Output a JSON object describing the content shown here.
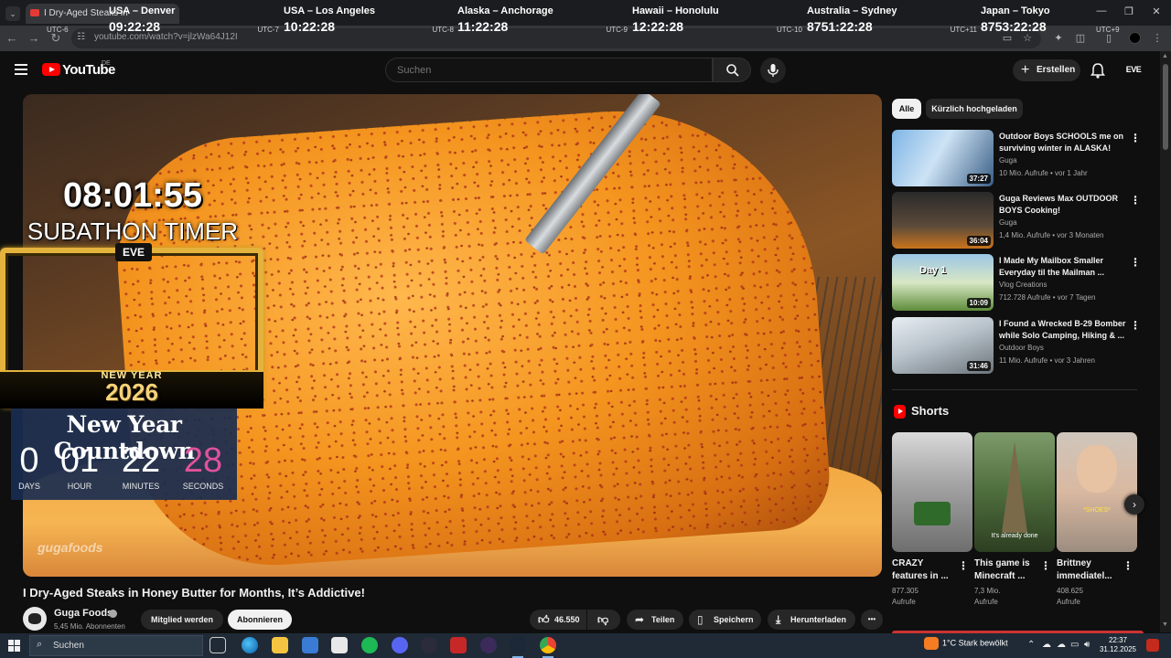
{
  "browser": {
    "tab_title": "I Dry-Aged Steaks in",
    "url": "youtube.com/watch?v=jlzWa64J12I"
  },
  "world_clocks": [
    {
      "city": "USA – Denver",
      "time": "09:22:28",
      "utc": "UTC-6"
    },
    {
      "city": "USA – Los Angeles",
      "time": "10:22:28",
      "utc": "UTC-7"
    },
    {
      "city": "Alaska – Anchorage",
      "time": "11:22:28",
      "utc": "UTC-8"
    },
    {
      "city": "Hawaii – Honolulu",
      "time": "12:22:28",
      "utc": "UTC-9"
    },
    {
      "city": "Australia – Sydney",
      "time": "8751:22:28",
      "utc": "UTC-10"
    },
    {
      "city": "Japan – Tokyo",
      "time": "8753:22:28",
      "utc": "UTC+11"
    }
  ],
  "extra_utc": "UTC+9",
  "youtube": {
    "logo_text": "YouTube",
    "country": "DE",
    "search_placeholder": "Suchen",
    "create_label": "Erstellen",
    "account_badge": "EVE"
  },
  "overlay": {
    "subathon_time": "08:01:55",
    "subathon_label": "SUBATHON TIMER",
    "frame_logo": "EVE",
    "new_year_small": "NEW YEAR",
    "new_year_big": "2026",
    "countdown_title": "New Year Countdown",
    "countdown": [
      {
        "value": "0",
        "label": "DAYS"
      },
      {
        "value": "01",
        "label": "HOUR"
      },
      {
        "value": "22",
        "label": "MINUTES"
      },
      {
        "value": "28",
        "label": "SECONDS"
      }
    ],
    "seconds_color": "#e0529a",
    "watermark": "gugafoods"
  },
  "video": {
    "title": "I Dry-Aged Steaks in Honey Butter for Months, It’s Addictive!",
    "channel": "Guga Foods",
    "subscribers": "5,45 Mio. Abonnenten",
    "join_label": "Mitglied werden",
    "subscribe_label": "Abonnieren",
    "likes": "46.550",
    "share_label": "Teilen",
    "save_label": "Speichern",
    "download_label": "Herunterladen",
    "more_label": "•••"
  },
  "sidebar": {
    "chips": [
      "Alle",
      "Kürzlich hochgeladen"
    ],
    "recommendations": [
      {
        "title": "Outdoor Boys SCHOOLS me on surviving winter in ALASKA!",
        "channel": "Guga",
        "meta": "10 Mio. Aufrufe • vor 1 Jahr",
        "duration": "37:27"
      },
      {
        "title": "Guga Reviews Max OUTDOOR BOYS Cooking!",
        "channel": "Guga",
        "meta": "1,4 Mio. Aufrufe • vor 3 Monaten",
        "duration": "36:04"
      },
      {
        "title": "I Made My Mailbox Smaller Everyday til the Mailman ...",
        "channel": "Vlog Creations",
        "meta": "712.728 Aufrufe • vor 7 Tagen",
        "duration": "10:09",
        "thumb_text": "Day 1"
      },
      {
        "title": "I Found a Wrecked B-29 Bomber while Solo Camping, Hiking & ...",
        "channel": "Outdoor Boys",
        "meta": "11 Mio. Aufrufe • vor 3 Jahren",
        "duration": "31:46"
      }
    ],
    "shorts_title": "Shorts",
    "shorts": [
      {
        "title": "CRAZY features in ...",
        "views": "877.305",
        "views_label": "Aufrufe"
      },
      {
        "title": "This game is Minecraft ...",
        "views": "7,3 Mio.",
        "views_label": "Aufrufe",
        "overlay": "It's already done"
      },
      {
        "title": "Brittney immediatel...",
        "views": "408.625",
        "views_label": "Aufrufe",
        "overlay": "*SHOES*"
      }
    ]
  },
  "taskbar": {
    "search_label": "Suchen",
    "weather": "1°C  Stark bewölkt",
    "time": "22:37",
    "date": "31.12.2025"
  }
}
